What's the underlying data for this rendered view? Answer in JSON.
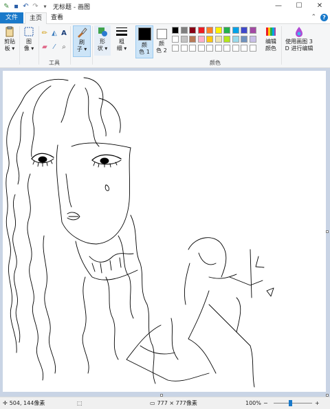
{
  "window": {
    "title": "无标题 - 画图",
    "controls": {
      "minimize": "—",
      "maximize": "☐",
      "close": "✕"
    }
  },
  "quick_access": {
    "icons": [
      "paint-app-icon",
      "save-icon",
      "undo-icon",
      "redo-icon",
      "customize-dropdown-icon"
    ]
  },
  "tabs": {
    "file": "文件",
    "home": "主页",
    "view": "查看",
    "help": "?"
  },
  "ribbon": {
    "clipboard": {
      "paste_line1": "剪贴",
      "paste_line2": "板 ▾"
    },
    "image": {
      "label_line1": "图",
      "label_line2": "像 ▾"
    },
    "tools": {
      "group_label": "工具"
    },
    "brushes": {
      "label_line1": "刷",
      "label_line2": "子 ▾"
    },
    "shapes": {
      "label_line1": "形",
      "label_line2": "状 ▾"
    },
    "size": {
      "label_line1": "粗",
      "label_line2": "细 ▾"
    },
    "color1": {
      "label_line1": "颜",
      "label_line2": "色 1",
      "value": "#000000"
    },
    "color2": {
      "label_line1": "颜",
      "label_line2": "色 2",
      "value": "#ffffff"
    },
    "edit_colors": {
      "label_line1": "编辑",
      "label_line2": "颜色"
    },
    "paint3d": {
      "label_line1": "使用画图 3",
      "label_line2": "D 进行编辑"
    },
    "colors_group_label": "颜色",
    "palette_row1": [
      "#000000",
      "#7f7f7f",
      "#880015",
      "#ed1c24",
      "#ff7f27",
      "#fff200",
      "#22b14c",
      "#00a2e8",
      "#3f48cc",
      "#a349a4"
    ],
    "palette_row2": [
      "#ffffff",
      "#c3c3c3",
      "#b97a57",
      "#ffaec9",
      "#ffc90e",
      "#efe4b0",
      "#b5e61d",
      "#99d9ea",
      "#7092be",
      "#c8bfe7"
    ],
    "palette_row3": [
      "#ffffff",
      "#ffffff",
      "#ffffff",
      "#ffffff",
      "#ffffff",
      "#ffffff",
      "#ffffff",
      "#ffffff",
      "#ffffff",
      "#ffffff"
    ]
  },
  "status": {
    "cursor_pos": "504, 144像素",
    "canvas_size": "777 × 777像素",
    "zoom": "100%",
    "zoom_out": "−",
    "zoom_in": "+"
  }
}
